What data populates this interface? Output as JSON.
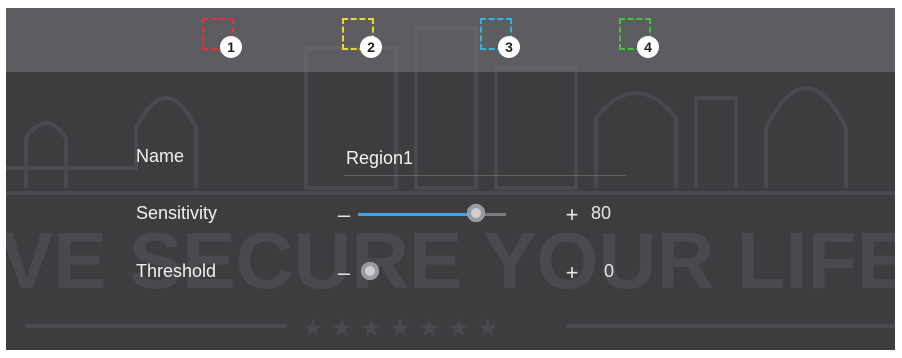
{
  "regions": [
    {
      "number": "1",
      "color": "#e0343a"
    },
    {
      "number": "2",
      "color": "#e8d92a"
    },
    {
      "number": "3",
      "color": "#2fb3e0"
    },
    {
      "number": "4",
      "color": "#3fc43a"
    }
  ],
  "form": {
    "name_label": "Name",
    "name_value": "Region1",
    "sensitivity_label": "Sensitivity",
    "sensitivity_value": "80",
    "sensitivity_level": 80,
    "threshold_label": "Threshold",
    "threshold_value": "0",
    "threshold_level": 0,
    "slider_max": 100,
    "minus_symbol": "–",
    "plus_symbol": "+"
  },
  "background": {
    "watermark_text": "VE SECURE YOUR LIFE",
    "stars": "★ ★ ★ ★ ★ ★ ★"
  },
  "colors": {
    "slider_fill": "#3fa2ee",
    "panel_bg": "#3d3d40"
  }
}
